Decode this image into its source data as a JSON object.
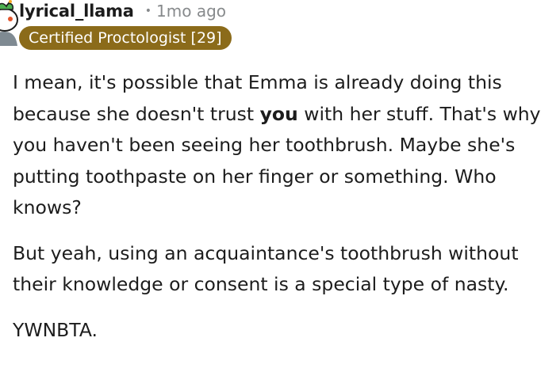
{
  "comment": {
    "username": "lyrical_llama",
    "separator": "•",
    "timestamp": "1mo ago",
    "flair": "Certified Proctologist [29]",
    "paragraph1": {
      "before": "I mean, it's possible that Emma is already doing this because she doesn't trust ",
      "emphasis": "you",
      "after": " with her stuff. That's why you haven't been seeing her toothbrush. Maybe she's putting toothpaste on her finger or something. Who knows?"
    },
    "paragraph2": "But yeah, using an acquaintance's toothbrush without their knowledge or consent is a special type of nasty.",
    "paragraph3": "YWNBTA."
  },
  "icons": {
    "avatar": "snoo-avatar-icon"
  },
  "colors": {
    "flair_background": "#8b6b1a",
    "flair_text": "#ffffff",
    "meta_text": "#878a8c",
    "body_text": "#1c1c1c"
  }
}
